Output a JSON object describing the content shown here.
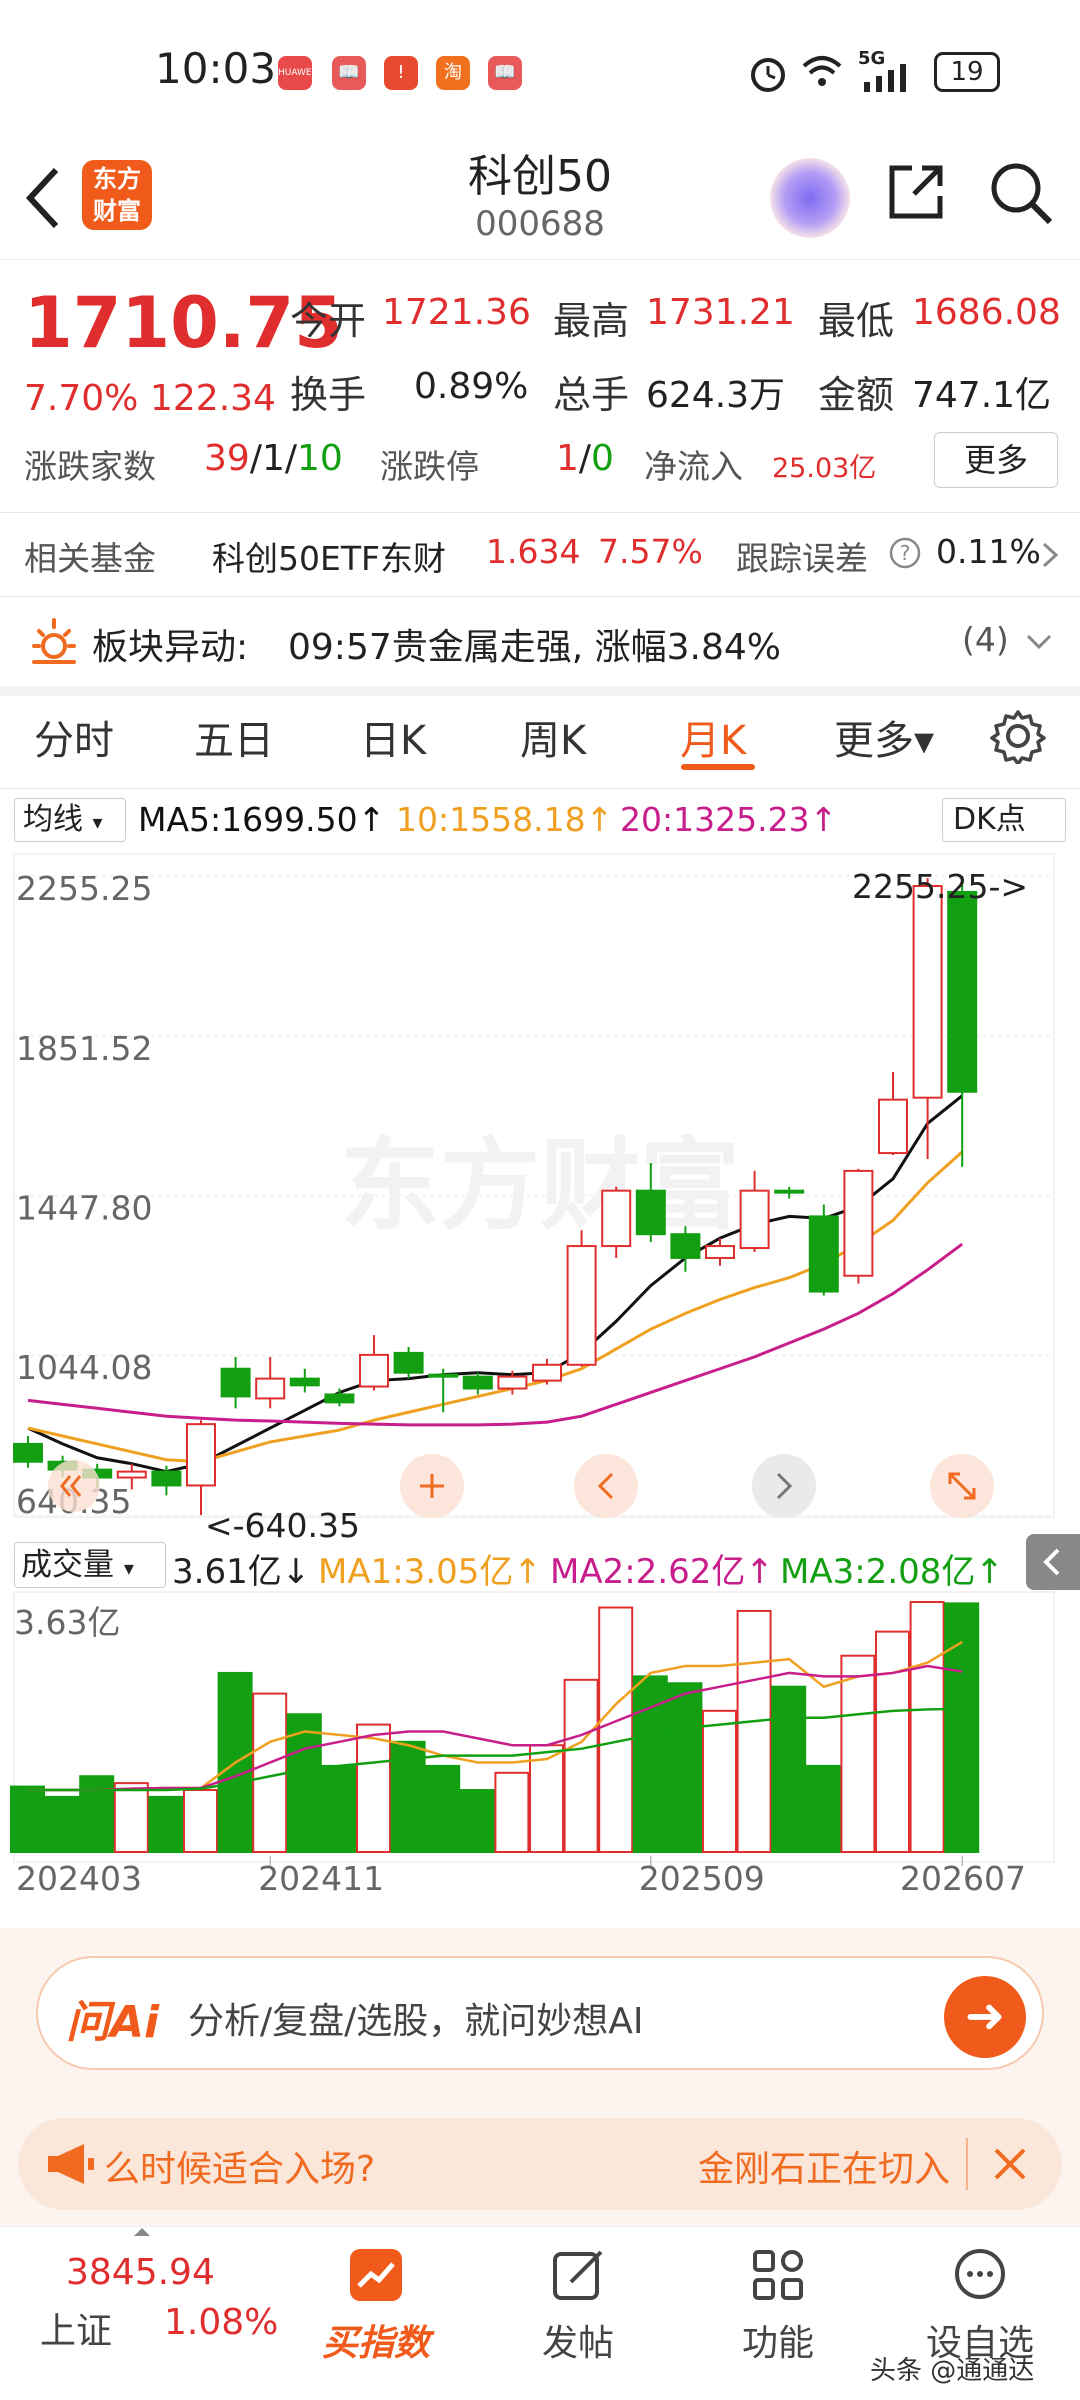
{
  "status_bar": {
    "time": "10:03",
    "apps": [
      "HUAWEI",
      "📖",
      "!",
      "淘",
      "📖"
    ],
    "network": "5G",
    "battery": "19"
  },
  "header": {
    "title": "科创50",
    "code": "000688",
    "logo": "东方财富"
  },
  "quote": {
    "price": "1710.75",
    "change_pct": "7.70%",
    "change_abs": "122.34",
    "open_label": "今开",
    "open": "1721.36",
    "high_label": "最高",
    "high": "1731.21",
    "low_label": "最低",
    "low": "1686.08",
    "turnover_label": "换手",
    "turnover": "0.89%",
    "volume_label": "总手",
    "volume": "624.3万",
    "amount_label": "金额",
    "amount": "747.1亿",
    "breadth_label": "涨跌家数",
    "breadth_up": "39",
    "breadth_flat": "1",
    "breadth_down": "10",
    "limit_label": "涨跌停",
    "limit_up": "1",
    "limit_down": "0",
    "netflow_label": "净流入",
    "netflow": "25.03亿",
    "more": "更多"
  },
  "fund": {
    "label": "相关基金",
    "name": "科创50ETF东财",
    "price": "1.634",
    "pct": "7.57%",
    "track_label": "跟踪误差",
    "track_value": "0.11%"
  },
  "sector": {
    "label": "板块异动:",
    "text": "09:57贵金属走强, 涨幅3.84%",
    "count": "(4)"
  },
  "tabs": [
    "分时",
    "五日",
    "日K",
    "周K",
    "月K",
    "更多▾"
  ],
  "active_tab": "月K",
  "ma_row": {
    "selector": "均线",
    "ma5": "MA5:1699.50↑",
    "ma10": "10:1558.18↑",
    "ma20": "20:1325.23↑",
    "dk": "DK点"
  },
  "vol_row": {
    "selector": "成交量",
    "vol": "3.61亿↓",
    "ma1": "MA1:3.05亿↑",
    "ma2": "MA2:2.62亿↑",
    "ma3": "MA3:2.08亿↑"
  },
  "colors": {
    "up": "#e02d2d",
    "down": "#12a012",
    "ma5": "#111111",
    "ma10": "#f0a020",
    "ma20": "#c81e8c",
    "accent": "#f05a1a"
  },
  "chart_data": {
    "type": "candlestick",
    "y_tick_labels": [
      "2255.25",
      "1851.52",
      "1447.80",
      "1044.08",
      "640.35"
    ],
    "ylim": [
      640.35,
      2255.25
    ],
    "max_label": "2255.25",
    "min_label": "640.35",
    "x_tick_labels": [
      "202403",
      "202411",
      "202509",
      "202607"
    ],
    "candles": [
      {
        "o": 820,
        "c": 775,
        "h": 840,
        "l": 760
      },
      {
        "o": 775,
        "c": 755,
        "h": 790,
        "l": 735
      },
      {
        "o": 755,
        "c": 735,
        "h": 770,
        "l": 710
      },
      {
        "o": 735,
        "c": 750,
        "h": 770,
        "l": 705
      },
      {
        "o": 750,
        "c": 715,
        "h": 765,
        "l": 690
      },
      {
        "o": 715,
        "c": 870,
        "h": 880,
        "l": 640
      },
      {
        "o": 1010,
        "c": 940,
        "h": 1040,
        "l": 910
      },
      {
        "o": 935,
        "c": 985,
        "h": 1040,
        "l": 910
      },
      {
        "o": 985,
        "c": 968,
        "h": 1010,
        "l": 950
      },
      {
        "o": 945,
        "c": 925,
        "h": 960,
        "l": 915
      },
      {
        "o": 965,
        "c": 1045,
        "h": 1095,
        "l": 955
      },
      {
        "o": 1050,
        "c": 1000,
        "h": 1065,
        "l": 985
      },
      {
        "o": 995,
        "c": 990,
        "h": 1010,
        "l": 900
      },
      {
        "o": 990,
        "c": 960,
        "h": 1000,
        "l": 945
      },
      {
        "o": 960,
        "c": 990,
        "h": 1005,
        "l": 945
      },
      {
        "o": 980,
        "c": 1020,
        "h": 1035,
        "l": 970
      },
      {
        "o": 1020,
        "c": 1320,
        "h": 1360,
        "l": 1015
      },
      {
        "o": 1320,
        "c": 1460,
        "h": 1470,
        "l": 1290
      },
      {
        "o": 1460,
        "c": 1350,
        "h": 1530,
        "l": 1330
      },
      {
        "o": 1350,
        "c": 1290,
        "h": 1370,
        "l": 1255
      },
      {
        "o": 1290,
        "c": 1320,
        "h": 1340,
        "l": 1270
      },
      {
        "o": 1315,
        "c": 1460,
        "h": 1510,
        "l": 1305
      },
      {
        "o": 1460,
        "c": 1455,
        "h": 1470,
        "l": 1440
      },
      {
        "o": 1395,
        "c": 1205,
        "h": 1425,
        "l": 1195
      },
      {
        "o": 1245,
        "c": 1510,
        "h": 1515,
        "l": 1225
      },
      {
        "o": 1555,
        "c": 1690,
        "h": 1760,
        "l": 1550
      },
      {
        "o": 1695,
        "c": 2230,
        "h": 2250,
        "l": 1540
      },
      {
        "o": 2215,
        "c": 1710,
        "h": 2255,
        "l": 1520
      }
    ],
    "series": [
      {
        "name": "MA5",
        "values": [
          860,
          820,
          785,
          770,
          750,
          770,
          815,
          860,
          905,
          950,
          980,
          985,
          995,
          1000,
          995,
          1000,
          1050,
          1130,
          1220,
          1290,
          1340,
          1375,
          1395,
          1390,
          1420,
          1490,
          1630,
          1700
        ]
      },
      {
        "name": "MA10",
        "values": [
          860,
          840,
          820,
          800,
          780,
          775,
          800,
          825,
          840,
          855,
          880,
          900,
          920,
          940,
          960,
          980,
          1010,
          1060,
          1110,
          1150,
          1185,
          1215,
          1240,
          1275,
          1325,
          1385,
          1480,
          1558
        ]
      },
      {
        "name": "MA20",
        "values": [
          930,
          920,
          910,
          900,
          890,
          885,
          880,
          878,
          875,
          872,
          870,
          868,
          868,
          868,
          870,
          875,
          890,
          920,
          950,
          980,
          1010,
          1040,
          1075,
          1110,
          1150,
          1200,
          1260,
          1325
        ]
      }
    ],
    "volume": {
      "ylim": [
        0,
        3.63
      ],
      "max_label": "3.63亿",
      "values": [
        0.95,
        0.8,
        1.1,
        1.0,
        0.8,
        0.9,
        2.6,
        2.3,
        2.0,
        1.25,
        1.85,
        1.6,
        1.25,
        0.9,
        1.15,
        1.55,
        2.5,
        3.55,
        2.55,
        2.45,
        2.05,
        3.5,
        2.4,
        1.25,
        2.85,
        3.2,
        3.63,
        3.61
      ],
      "ma1": [
        0.9,
        0.9,
        0.9,
        0.92,
        0.93,
        0.93,
        1.3,
        1.6,
        1.75,
        1.7,
        1.65,
        1.55,
        1.4,
        1.3,
        1.3,
        1.35,
        1.6,
        2.15,
        2.6,
        2.7,
        2.7,
        2.75,
        2.8,
        2.4,
        2.55,
        2.6,
        2.75,
        3.05
      ],
      "ma2": [
        0.9,
        0.9,
        0.9,
        0.92,
        0.93,
        0.93,
        1.1,
        1.3,
        1.5,
        1.6,
        1.7,
        1.75,
        1.75,
        1.65,
        1.55,
        1.55,
        1.7,
        1.9,
        2.1,
        2.3,
        2.4,
        2.5,
        2.6,
        2.55,
        2.55,
        2.6,
        2.7,
        2.62
      ],
      "ma3": [
        0.9,
        0.9,
        0.9,
        0.9,
        0.9,
        0.92,
        1.0,
        1.1,
        1.2,
        1.25,
        1.3,
        1.35,
        1.4,
        1.4,
        1.4,
        1.45,
        1.5,
        1.6,
        1.7,
        1.8,
        1.85,
        1.9,
        1.95,
        1.95,
        2.0,
        2.05,
        2.07,
        2.08
      ]
    }
  },
  "ai": {
    "brand": "问Ai",
    "placeholder": "分析/复盘/选股，就问妙想AI"
  },
  "announce": {
    "left": "么时候适合入场?",
    "right": "金刚石正在切入"
  },
  "bottom_nav": {
    "index_value": "3845.94",
    "index_name": "上证",
    "index_pct": "1.08%",
    "items": [
      "买指数",
      "发帖",
      "功能",
      "设自选"
    ]
  },
  "watermark_text": "东方财富",
  "footer_watermark": "头条 @通通达"
}
